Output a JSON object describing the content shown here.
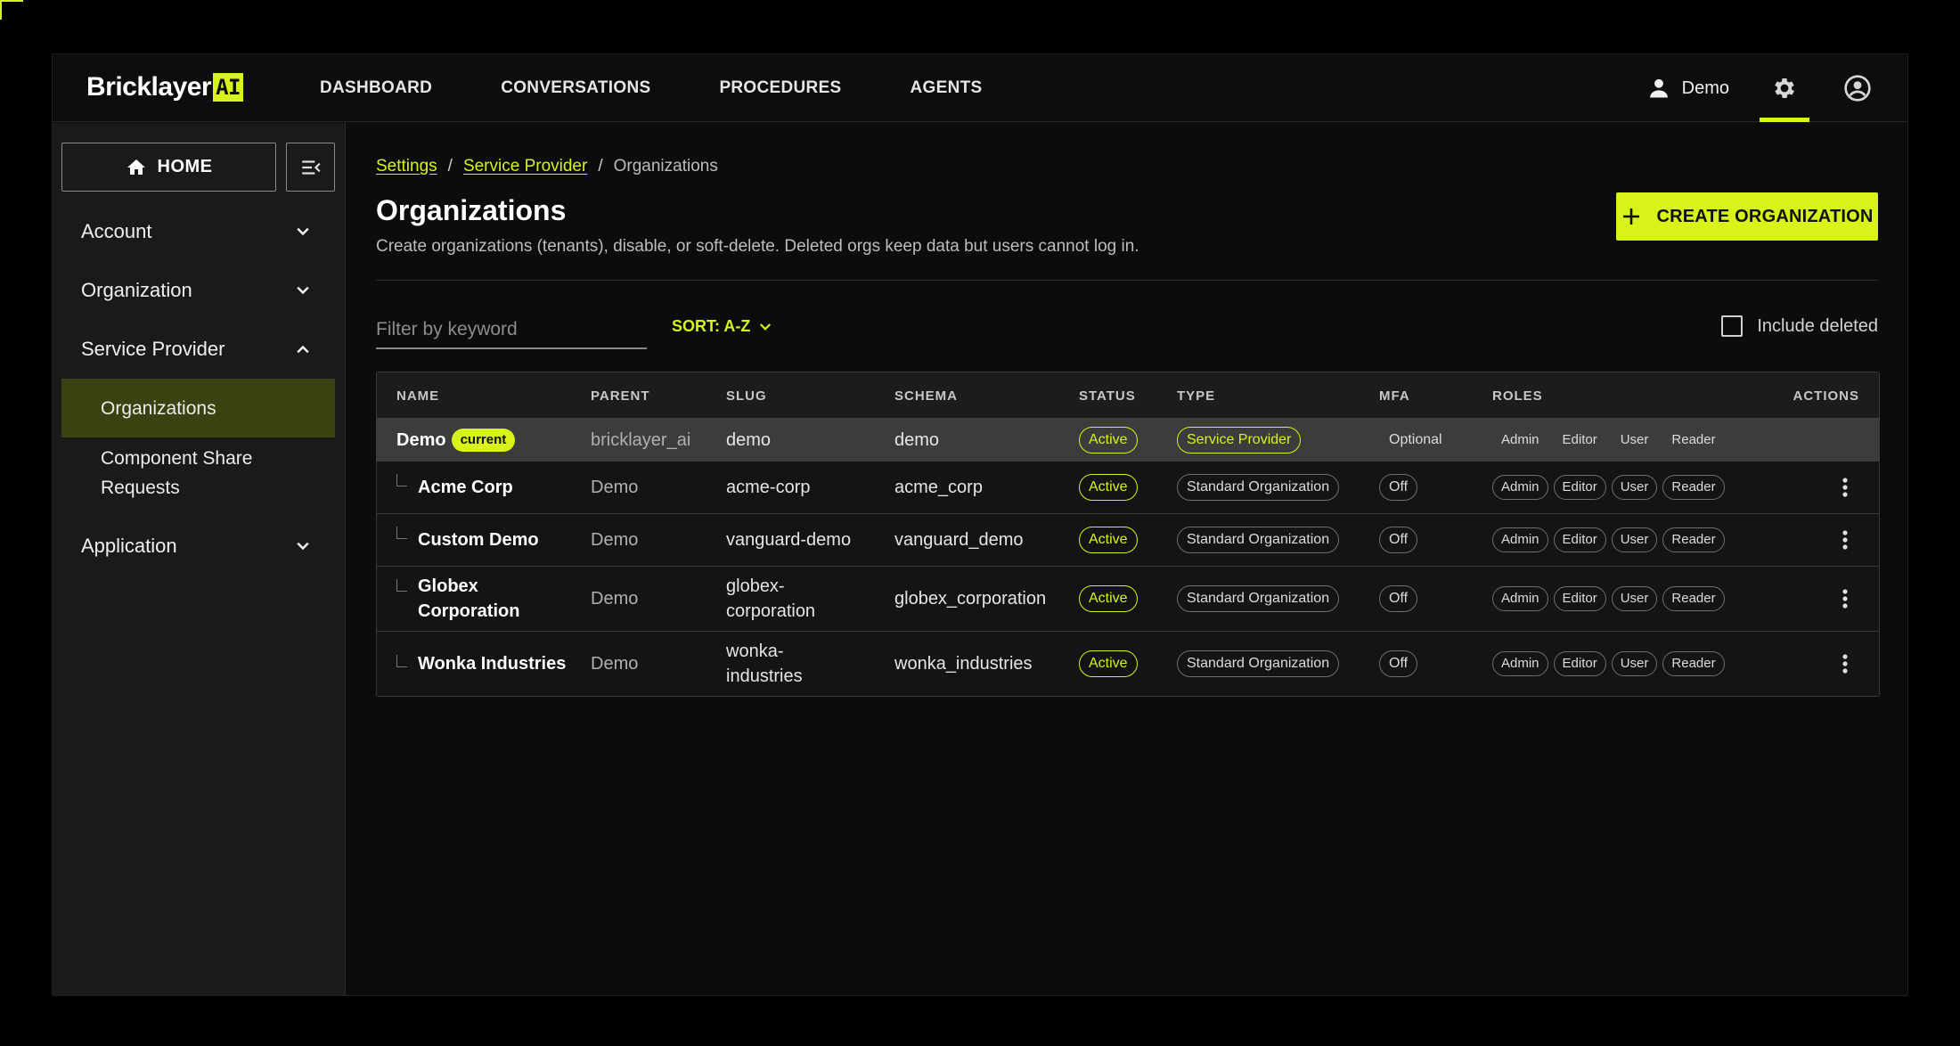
{
  "brand": {
    "name": "Bricklayer",
    "ai": "AI"
  },
  "nav": {
    "links": [
      "DASHBOARD",
      "CONVERSATIONS",
      "PROCEDURES",
      "AGENTS"
    ],
    "user": "Demo"
  },
  "sidebar": {
    "home": "HOME",
    "items": [
      {
        "label": "Account",
        "icon": "chevron-down-icon"
      },
      {
        "label": "Organization",
        "icon": "chevron-down-icon"
      },
      {
        "label": "Service Provider",
        "icon": "chevron-up-icon"
      },
      {
        "label": "Application",
        "icon": "chevron-down-icon"
      }
    ],
    "sub_items": [
      "Organizations",
      "Component Share Requests"
    ]
  },
  "breadcrumb": {
    "items": [
      "Settings",
      "Service Provider",
      "Organizations"
    ],
    "separator": "/"
  },
  "page": {
    "title": "Organizations",
    "description": "Create organizations (tenants), disable, or soft-delete. Deleted orgs keep data but users cannot log in.",
    "create_button": "CREATE ORGANIZATION"
  },
  "filters": {
    "placeholder": "Filter by keyword",
    "sort": "SORT: A-Z",
    "include_deleted": "Include deleted",
    "include_deleted_checked": false
  },
  "table": {
    "columns": [
      "NAME",
      "PARENT",
      "SLUG",
      "SCHEMA",
      "STATUS",
      "TYPE",
      "MFA",
      "ROLES",
      "ACTIONS"
    ],
    "current_badge": "current",
    "rows": [
      {
        "name": "Demo",
        "parent": "bricklayer_ai",
        "slug": "demo",
        "schema": "demo",
        "status": "Active",
        "type": "Service Provider",
        "mfa": "Optional",
        "roles": [
          "Admin",
          "Editor",
          "User",
          "Reader"
        ],
        "current": true
      },
      {
        "name": "Acme Corp",
        "parent": "Demo",
        "slug": "acme-corp",
        "schema": "acme_corp",
        "status": "Active",
        "type": "Standard Organization",
        "mfa": "Off",
        "roles": [
          "Admin",
          "Editor",
          "User",
          "Reader"
        ]
      },
      {
        "name": "Custom Demo",
        "parent": "Demo",
        "slug": "vanguard-demo",
        "schema": "vanguard_demo",
        "status": "Active",
        "type": "Standard Organization",
        "mfa": "Off",
        "roles": [
          "Admin",
          "Editor",
          "User",
          "Reader"
        ]
      },
      {
        "name": "Globex Corporation",
        "parent": "Demo",
        "slug": "globex-corporation",
        "schema": "globex_corporation",
        "status": "Active",
        "type": "Standard Organization",
        "mfa": "Off",
        "roles": [
          "Admin",
          "Editor",
          "User",
          "Reader"
        ]
      },
      {
        "name": "Wonka Industries",
        "parent": "Demo",
        "slug": "wonka-industries",
        "schema": "wonka_industries",
        "status": "Active",
        "type": "Standard Organization",
        "mfa": "Off",
        "roles": [
          "Admin",
          "Editor",
          "User",
          "Reader"
        ]
      }
    ]
  },
  "colors": {
    "accent": "#d8f31a",
    "background": "#0c0c0c",
    "sidebar": "#1a1a1a",
    "active_item": "#3a4212"
  }
}
